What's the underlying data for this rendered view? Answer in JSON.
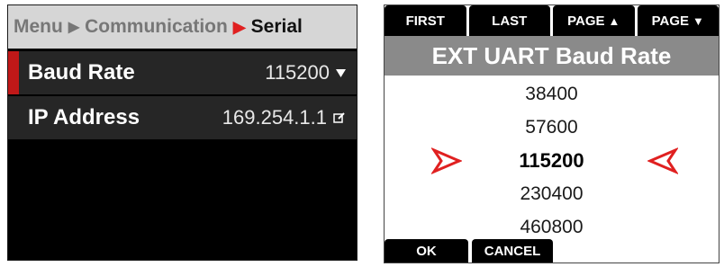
{
  "menu_screen": {
    "breadcrumb": {
      "root": "Menu",
      "middle": "Communication",
      "current": "Serial",
      "separator": "▶"
    },
    "rows": [
      {
        "label": "Baud Rate",
        "value": "115200",
        "icon": "chevron-down-icon"
      },
      {
        "label": "IP Address",
        "value": "169.254.1.1",
        "icon": "edit-icon"
      }
    ],
    "colors": {
      "accent": "#c01818",
      "breadcrumb_sep": "#e02020",
      "row_bg": "#262626"
    }
  },
  "baud_picker": {
    "nav": {
      "first": "FIRST",
      "last": "LAST",
      "page_up": "PAGE",
      "page_down": "PAGE"
    },
    "title": "EXT UART Baud Rate",
    "options": [
      "38400",
      "57600",
      "115200",
      "230400",
      "460800"
    ],
    "selected": "115200",
    "actions": {
      "ok": "OK",
      "cancel": "CANCEL"
    },
    "colors": {
      "selector_arrows": "#e02020",
      "title_bg": "#8a8a8a"
    }
  }
}
